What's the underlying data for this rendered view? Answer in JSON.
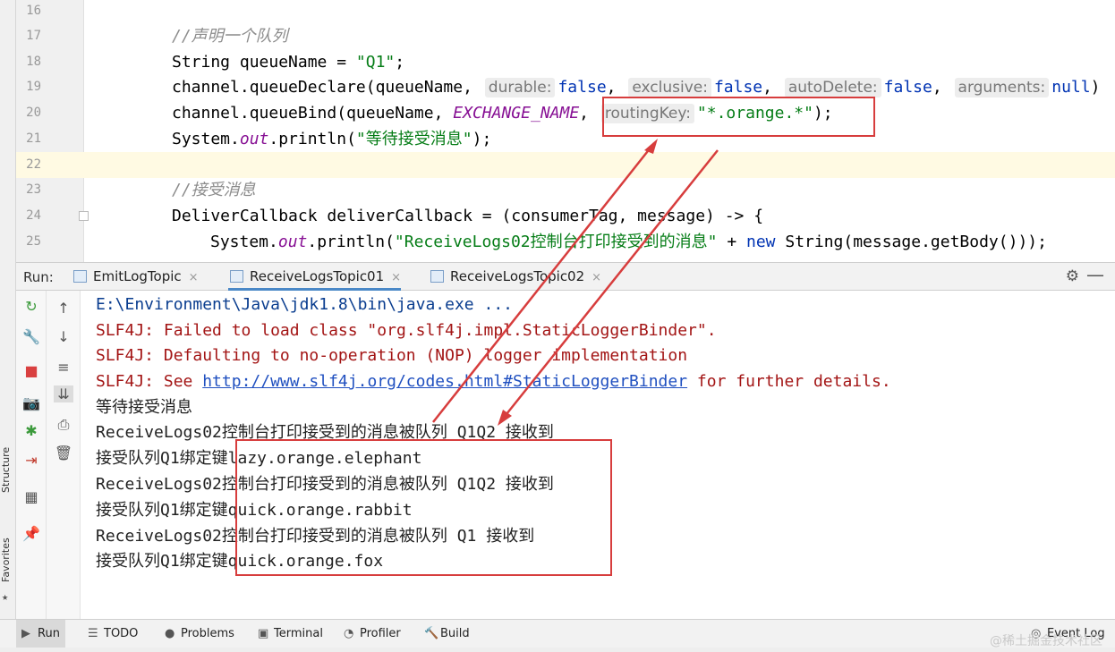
{
  "side_labels": {
    "structure": "Structure",
    "favorites": "Favorites"
  },
  "editor": {
    "line_numbers": [
      "16",
      "17",
      "18",
      "19",
      "20",
      "21",
      "22",
      "23",
      "24",
      "25"
    ],
    "l17_comment": "//声明一个队列",
    "l18_a": "String queueName = ",
    "l18_str": "\"Q1\"",
    "l18_b": ";",
    "l19_a": "channel.queueDeclare(queueName, ",
    "l19_h1": "durable:",
    "l19_v1": "false",
    "l19_h2": "exclusive:",
    "l19_v2": "false",
    "l19_h3": "autoDelete:",
    "l19_v3": "false",
    "l19_h4": "arguments:",
    "l19_v4": "null",
    "l19_end": ")",
    "l20_a": "channel.queueBind(queueName, ",
    "l20_field": "EXCHANGE_NAME",
    "l20_comma": ", ",
    "l20_hint": "routingKey:",
    "l20_str": "\"*.orange.*\"",
    "l20_end": ");",
    "l21_a": "System.",
    "l21_out": "out",
    "l21_b": ".println(",
    "l21_str": "\"等待接受消息\"",
    "l21_end": ");",
    "l23_comment": "//接受消息",
    "l24": "DeliverCallback deliverCallback = (consumerTag, message) -> {",
    "l25_a": "System.",
    "l25_out": "out",
    "l25_b": ".println(",
    "l25_str": "\"ReceiveLogs02控制台打印接受到的消息\"",
    "l25_c": " + ",
    "l25_kw": "new",
    "l25_d": " String(message.getBody()));"
  },
  "run_panel": {
    "label": "Run:",
    "tabs": [
      {
        "label": "EmitLogTopic",
        "active": false
      },
      {
        "label": "ReceiveLogsTopic01",
        "active": true
      },
      {
        "label": "ReceiveLogsTopic02",
        "active": false
      }
    ],
    "close_glyph": "×"
  },
  "console": {
    "cmd": "E:\\Environment\\Java\\jdk1.8\\bin\\java.exe ...",
    "slf1": "SLF4J: Failed to load class \"org.slf4j.impl.StaticLoggerBinder\".",
    "slf2": "SLF4J: Defaulting to no-operation (NOP) logger implementation",
    "slf3_a": "SLF4J: See ",
    "slf3_link": "http://www.slf4j.org/codes.html#StaticLoggerBinder",
    "slf3_b": " for further details.",
    "wait": "等待接受消息",
    "m1": "ReceiveLogs02控制台打印接受到的消息被队列 Q1Q2 接收到",
    "m2": "接受队列Q1绑定键lazy.orange.elephant",
    "m3": "ReceiveLogs02控制台打印接受到的消息被队列 Q1Q2 接收到",
    "m4": "接受队列Q1绑定键quick.orange.rabbit",
    "m5": "ReceiveLogs02控制台打印接受到的消息被队列 Q1 接收到",
    "m6": "接受队列Q1绑定键quick.orange.fox"
  },
  "bottom_bar": {
    "run": "Run",
    "todo": "TODO",
    "problems": "Problems",
    "terminal": "Terminal",
    "profiler": "Profiler",
    "build": "Build",
    "event_log": "Event Log"
  },
  "watermark": "@稀土掘金技术社区",
  "colors": {
    "annotation_red": "#d73d3d",
    "active_tab": "#4a88c7",
    "error_text": "#a31515",
    "link": "#2050c0"
  }
}
